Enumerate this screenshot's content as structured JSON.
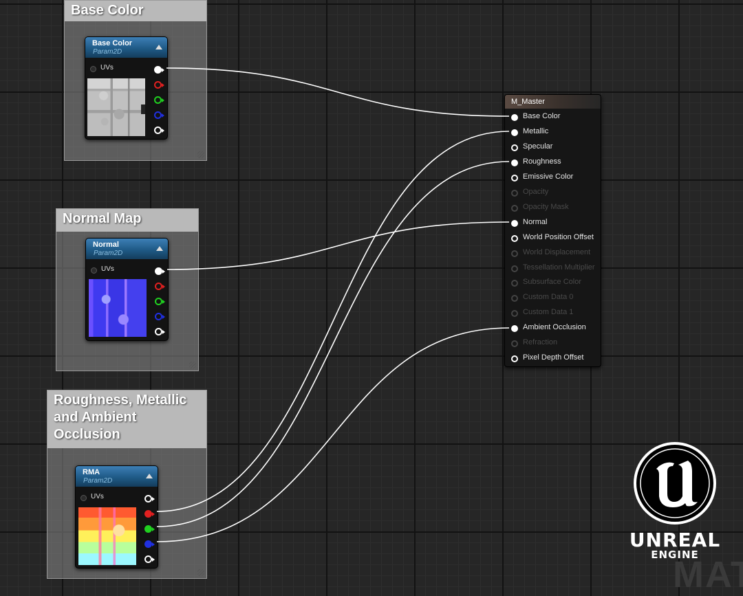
{
  "comments": [
    {
      "id": "base-color",
      "title": "Base Color"
    },
    {
      "id": "normal-map",
      "title": "Normal Map"
    },
    {
      "id": "rma",
      "title": "Roughness, Metallic\nand Ambient\nOcclusion"
    }
  ],
  "texture_nodes": [
    {
      "id": "base-color",
      "title": "Base Color",
      "subtitle": "Param2D",
      "uv_label": "UVs"
    },
    {
      "id": "normal",
      "title": "Normal",
      "subtitle": "Param2D",
      "uv_label": "UVs"
    },
    {
      "id": "rma",
      "title": "RMA",
      "subtitle": "Param2D",
      "uv_label": "UVs"
    }
  ],
  "master_node": {
    "title": "M_Master",
    "pins": [
      {
        "label": "Base Color",
        "state": "connected"
      },
      {
        "label": "Metallic",
        "state": "connected"
      },
      {
        "label": "Specular",
        "state": "open"
      },
      {
        "label": "Roughness",
        "state": "connected"
      },
      {
        "label": "Emissive Color",
        "state": "open"
      },
      {
        "label": "Opacity",
        "state": "disabled"
      },
      {
        "label": "Opacity Mask",
        "state": "disabled"
      },
      {
        "label": "Normal",
        "state": "connected"
      },
      {
        "label": "World Position Offset",
        "state": "open"
      },
      {
        "label": "World Displacement",
        "state": "disabled"
      },
      {
        "label": "Tessellation Multiplier",
        "state": "disabled"
      },
      {
        "label": "Subsurface Color",
        "state": "disabled"
      },
      {
        "label": "Custom Data 0",
        "state": "disabled"
      },
      {
        "label": "Custom Data 1",
        "state": "disabled"
      },
      {
        "label": "Ambient Occlusion",
        "state": "connected"
      },
      {
        "label": "Refraction",
        "state": "disabled"
      },
      {
        "label": "Pixel Depth Offset",
        "state": "open"
      }
    ]
  },
  "connections": [
    {
      "from": "Base Color.RGB",
      "to": "Base Color"
    },
    {
      "from": "Normal.RGB",
      "to": "Normal"
    },
    {
      "from": "RMA.R",
      "to": "Metallic"
    },
    {
      "from": "RMA.G",
      "to": "Roughness"
    },
    {
      "from": "RMA.B",
      "to": "Ambient Occlusion"
    }
  ],
  "pin_colors": {
    "rgb": "#ffffff",
    "r": "#e02020",
    "g": "#20d020",
    "b": "#2030e0",
    "a": "#ffffff"
  },
  "logo": {
    "word": "UNREAL",
    "sub": "ENGINE"
  },
  "watermark": "MAT"
}
